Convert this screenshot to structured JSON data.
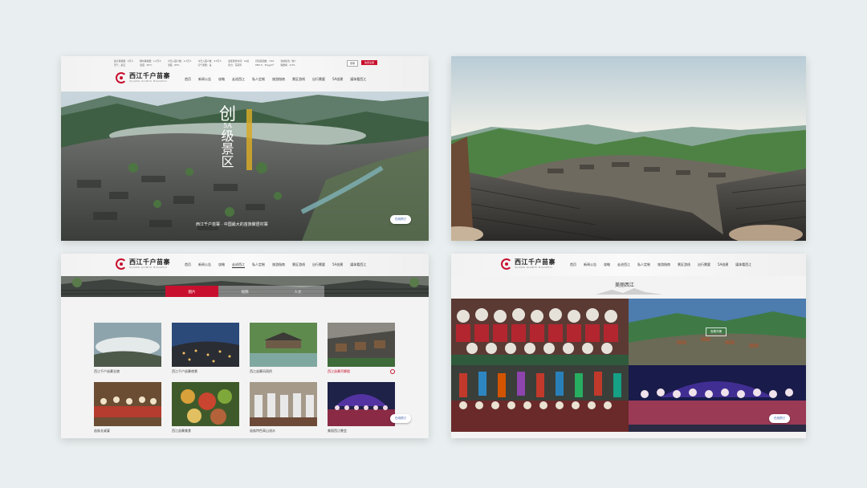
{
  "site": {
    "logo_cn": "西江千户苗寨",
    "logo_en": "XIJIANG QIANHU MIAOZHAI",
    "nav": [
      "首页",
      "新闻公告",
      "攻略",
      "走进西江",
      "私人定制",
      "旅游指南",
      "景区游线",
      "出行需要",
      "5A创建",
      "媒体看西江"
    ]
  },
  "top_bar": {
    "columns": [
      [
        "最大承载量：2万人",
        "天气：多云"
      ],
      [
        "瞬时承载量：1.2万人",
        "温度：26°C"
      ],
      [
        "今日入园人数：1.2万人",
        "湿度：65%"
      ],
      [
        "今日入园人数：4.5万人",
        "空气质量：良"
      ],
      [
        "最佳观景时间：16点",
        "风力：东南风"
      ],
      [
        "舒适度指数：7/10",
        "PM2.5：35μg/m³"
      ],
      [
        "当前客流：较少",
        "容量率：4.5%"
      ]
    ],
    "login": "登录",
    "register": "免费注册"
  },
  "hero": {
    "badge_1": "创",
    "badge_2": "5A",
    "badge_3": "级",
    "badge_4": "景",
    "badge_5": "区",
    "caption": "西江千户苗寨 · 中国最大的苗族聚居村寨",
    "cta": "在线预订"
  },
  "gallery": {
    "tabs": [
      "图片",
      "视频",
      "人文"
    ],
    "items": [
      {
        "caption": "西江千户苗寨全貌"
      },
      {
        "caption": "西江千户苗寨夜景"
      },
      {
        "caption": "西江苗寨风雨桥"
      },
      {
        "caption": "西江苗寨吊脚楼",
        "highlight": true
      },
      {
        "caption": "苗族长桌宴"
      },
      {
        "caption": "西江苗寨美食"
      },
      {
        "caption": "苗族特色高山流水"
      },
      {
        "caption": "美丽西江晚会"
      }
    ],
    "cta": "在线预订"
  },
  "feature": {
    "section_title": "美丽西江",
    "tile_btn_1": "查看详情",
    "tile_btn_2": "查看详情",
    "cta": "在线预订"
  },
  "colors": {
    "brand_red": "#c8102e",
    "cta_blue": "#3a5ca8"
  }
}
